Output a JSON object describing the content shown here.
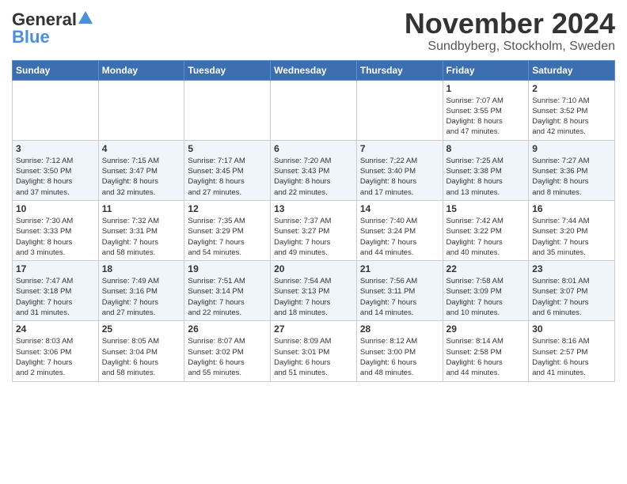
{
  "header": {
    "logo_general": "General",
    "logo_blue": "Blue",
    "month_title": "November 2024",
    "location": "Sundbyberg, Stockholm, Sweden"
  },
  "days_of_week": [
    "Sunday",
    "Monday",
    "Tuesday",
    "Wednesday",
    "Thursday",
    "Friday",
    "Saturday"
  ],
  "weeks": [
    {
      "cells": [
        {
          "day": "",
          "info": ""
        },
        {
          "day": "",
          "info": ""
        },
        {
          "day": "",
          "info": ""
        },
        {
          "day": "",
          "info": ""
        },
        {
          "day": "",
          "info": ""
        },
        {
          "day": "1",
          "info": "Sunrise: 7:07 AM\nSunset: 3:55 PM\nDaylight: 8 hours\nand 47 minutes."
        },
        {
          "day": "2",
          "info": "Sunrise: 7:10 AM\nSunset: 3:52 PM\nDaylight: 8 hours\nand 42 minutes."
        }
      ]
    },
    {
      "cells": [
        {
          "day": "3",
          "info": "Sunrise: 7:12 AM\nSunset: 3:50 PM\nDaylight: 8 hours\nand 37 minutes."
        },
        {
          "day": "4",
          "info": "Sunrise: 7:15 AM\nSunset: 3:47 PM\nDaylight: 8 hours\nand 32 minutes."
        },
        {
          "day": "5",
          "info": "Sunrise: 7:17 AM\nSunset: 3:45 PM\nDaylight: 8 hours\nand 27 minutes."
        },
        {
          "day": "6",
          "info": "Sunrise: 7:20 AM\nSunset: 3:43 PM\nDaylight: 8 hours\nand 22 minutes."
        },
        {
          "day": "7",
          "info": "Sunrise: 7:22 AM\nSunset: 3:40 PM\nDaylight: 8 hours\nand 17 minutes."
        },
        {
          "day": "8",
          "info": "Sunrise: 7:25 AM\nSunset: 3:38 PM\nDaylight: 8 hours\nand 13 minutes."
        },
        {
          "day": "9",
          "info": "Sunrise: 7:27 AM\nSunset: 3:36 PM\nDaylight: 8 hours\nand 8 minutes."
        }
      ]
    },
    {
      "cells": [
        {
          "day": "10",
          "info": "Sunrise: 7:30 AM\nSunset: 3:33 PM\nDaylight: 8 hours\nand 3 minutes."
        },
        {
          "day": "11",
          "info": "Sunrise: 7:32 AM\nSunset: 3:31 PM\nDaylight: 7 hours\nand 58 minutes."
        },
        {
          "day": "12",
          "info": "Sunrise: 7:35 AM\nSunset: 3:29 PM\nDaylight: 7 hours\nand 54 minutes."
        },
        {
          "day": "13",
          "info": "Sunrise: 7:37 AM\nSunset: 3:27 PM\nDaylight: 7 hours\nand 49 minutes."
        },
        {
          "day": "14",
          "info": "Sunrise: 7:40 AM\nSunset: 3:24 PM\nDaylight: 7 hours\nand 44 minutes."
        },
        {
          "day": "15",
          "info": "Sunrise: 7:42 AM\nSunset: 3:22 PM\nDaylight: 7 hours\nand 40 minutes."
        },
        {
          "day": "16",
          "info": "Sunrise: 7:44 AM\nSunset: 3:20 PM\nDaylight: 7 hours\nand 35 minutes."
        }
      ]
    },
    {
      "cells": [
        {
          "day": "17",
          "info": "Sunrise: 7:47 AM\nSunset: 3:18 PM\nDaylight: 7 hours\nand 31 minutes."
        },
        {
          "day": "18",
          "info": "Sunrise: 7:49 AM\nSunset: 3:16 PM\nDaylight: 7 hours\nand 27 minutes."
        },
        {
          "day": "19",
          "info": "Sunrise: 7:51 AM\nSunset: 3:14 PM\nDaylight: 7 hours\nand 22 minutes."
        },
        {
          "day": "20",
          "info": "Sunrise: 7:54 AM\nSunset: 3:13 PM\nDaylight: 7 hours\nand 18 minutes."
        },
        {
          "day": "21",
          "info": "Sunrise: 7:56 AM\nSunset: 3:11 PM\nDaylight: 7 hours\nand 14 minutes."
        },
        {
          "day": "22",
          "info": "Sunrise: 7:58 AM\nSunset: 3:09 PM\nDaylight: 7 hours\nand 10 minutes."
        },
        {
          "day": "23",
          "info": "Sunrise: 8:01 AM\nSunset: 3:07 PM\nDaylight: 7 hours\nand 6 minutes."
        }
      ]
    },
    {
      "cells": [
        {
          "day": "24",
          "info": "Sunrise: 8:03 AM\nSunset: 3:06 PM\nDaylight: 7 hours\nand 2 minutes."
        },
        {
          "day": "25",
          "info": "Sunrise: 8:05 AM\nSunset: 3:04 PM\nDaylight: 6 hours\nand 58 minutes."
        },
        {
          "day": "26",
          "info": "Sunrise: 8:07 AM\nSunset: 3:02 PM\nDaylight: 6 hours\nand 55 minutes."
        },
        {
          "day": "27",
          "info": "Sunrise: 8:09 AM\nSunset: 3:01 PM\nDaylight: 6 hours\nand 51 minutes."
        },
        {
          "day": "28",
          "info": "Sunrise: 8:12 AM\nSunset: 3:00 PM\nDaylight: 6 hours\nand 48 minutes."
        },
        {
          "day": "29",
          "info": "Sunrise: 8:14 AM\nSunset: 2:58 PM\nDaylight: 6 hours\nand 44 minutes."
        },
        {
          "day": "30",
          "info": "Sunrise: 8:16 AM\nSunset: 2:57 PM\nDaylight: 6 hours\nand 41 minutes."
        }
      ]
    }
  ]
}
